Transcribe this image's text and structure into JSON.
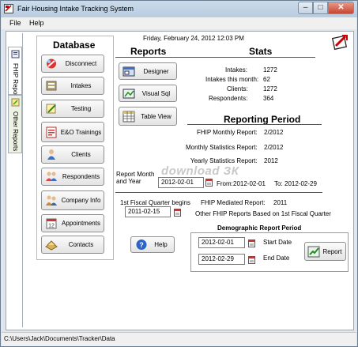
{
  "window": {
    "title": "Fair Housing Intake Tracking System",
    "controls": {
      "minimize": "–",
      "maximize": "□",
      "close": "✕"
    }
  },
  "menu": {
    "file": "File",
    "help": "Help"
  },
  "tabs": [
    "FHIP Reports",
    "Other Reports"
  ],
  "database": {
    "title": "Database",
    "buttons": [
      {
        "label": "Disconnect",
        "icon": "disconnect-icon"
      },
      {
        "label": "Intakes",
        "icon": "intakes-icon"
      },
      {
        "label": "Testing",
        "icon": "testing-icon"
      },
      {
        "label": "E&O Trainings",
        "icon": "trainings-icon"
      },
      {
        "label": "Clients",
        "icon": "clients-icon"
      },
      {
        "label": "Respondents",
        "icon": "respondents-icon"
      },
      {
        "label": "Company Info",
        "icon": "company-icon"
      },
      {
        "label": "Appointments",
        "icon": "calendar-icon"
      },
      {
        "label": "Contacts",
        "icon": "contacts-icon"
      }
    ]
  },
  "datetime": "Friday, February 24, 2012 12:03 PM",
  "reports": {
    "title": "Reports",
    "buttons": [
      {
        "label": "Designer",
        "icon": "designer-icon"
      },
      {
        "label": "Visual Sql",
        "icon": "sql-icon"
      },
      {
        "label": "Table View",
        "icon": "table-icon"
      }
    ]
  },
  "help": {
    "label": "Help",
    "icon": "help-icon"
  },
  "stats": {
    "title": "Stats",
    "rows": [
      {
        "label": "Intakes:",
        "value": "1272"
      },
      {
        "label": "Intakes this month:",
        "value": "62"
      },
      {
        "label": "Clients:",
        "value": "1272"
      },
      {
        "label": "Respondents:",
        "value": "364"
      }
    ]
  },
  "reporting_period": {
    "title": "Reporting Period",
    "rows": [
      {
        "label": "FHIP Monthly Report:",
        "value": "2/2012"
      },
      {
        "label": "Monthly Statistics Report:",
        "value": "2/2012"
      },
      {
        "label": "Yearly Statistics Report:",
        "value": "2012"
      }
    ]
  },
  "report_month": {
    "label": "Report Month and Year",
    "value": "2012-02-01",
    "from_label": "From:",
    "from_value": "2012-02-01",
    "to_label": "To:",
    "to_value": "2012-02-29"
  },
  "fiscal": {
    "label": "1st Fiscal Quarter begins",
    "value": "2011-02-15",
    "mediated_label": "FHIP Mediated Report:",
    "mediated_value": "2011",
    "other_label": "Other FHIP Reports Based on 1st Fiscal Quarter"
  },
  "demographic": {
    "title": "Demographic Report Period",
    "start_value": "2012-02-01",
    "start_label": "Start Date",
    "end_value": "2012-02-29",
    "end_label": "End Date",
    "report_button": "Report"
  },
  "watermark": "download ЗК",
  "status": {
    "path": "C:\\Users\\Jack\\Documents\\Tracker\\Data"
  }
}
